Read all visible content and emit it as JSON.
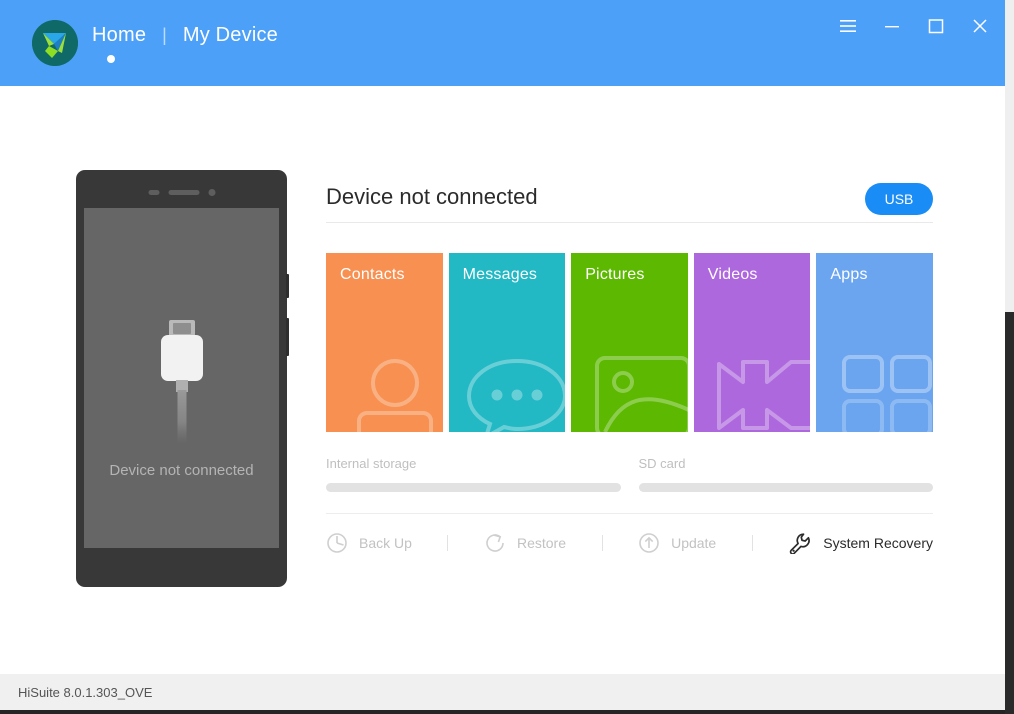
{
  "window": {
    "app_name": "HiSuite",
    "logo_icon": "hisuite-logo-icon"
  },
  "titlebar": {
    "nav": [
      {
        "label": "Home",
        "active": true
      },
      {
        "label": "My Device",
        "active": false
      }
    ],
    "separator": "|",
    "controls": [
      {
        "name": "menu-button",
        "icon": "hamburger-menu-icon"
      },
      {
        "name": "minimize-button",
        "icon": "minimize-icon"
      },
      {
        "name": "maximize-button",
        "icon": "maximize-icon"
      },
      {
        "name": "close-button",
        "icon": "close-icon"
      }
    ],
    "bg_color": "#4CA0F8"
  },
  "phone": {
    "caption": "Device not connected",
    "icon": "usb-connector-icon",
    "body_color": "#383838",
    "screen_color": "#666666"
  },
  "panel": {
    "status_title": "Device not connected",
    "usb_button": {
      "label": "USB",
      "color": "#1A8CF5"
    }
  },
  "tiles": [
    {
      "label": "Contacts",
      "color": "#F79050",
      "icon": "contact-person-icon"
    },
    {
      "label": "Messages",
      "color": "#22B8C4",
      "icon": "speech-bubble-icon"
    },
    {
      "label": "Pictures",
      "color": "#5CB800",
      "icon": "photo-frame-icon"
    },
    {
      "label": "Videos",
      "color": "#AE68DE",
      "icon": "film-strip-icon"
    },
    {
      "label": "Apps",
      "color": "#6BA5F0",
      "icon": "app-grid-icon"
    }
  ],
  "storage": [
    {
      "label": "Internal storage",
      "percent": 0
    },
    {
      "label": "SD card",
      "percent": 0
    }
  ],
  "actions": [
    {
      "label": "Back Up",
      "icon": "backup-clock-icon",
      "enabled": false
    },
    {
      "label": "Restore",
      "icon": "restore-arrow-icon",
      "enabled": false
    },
    {
      "label": "Update",
      "icon": "update-upload-icon",
      "enabled": false
    },
    {
      "label": "System Recovery",
      "icon": "wrench-icon",
      "enabled": true
    }
  ],
  "statusbar": {
    "version": "HiSuite 8.0.1.303_OVE"
  }
}
